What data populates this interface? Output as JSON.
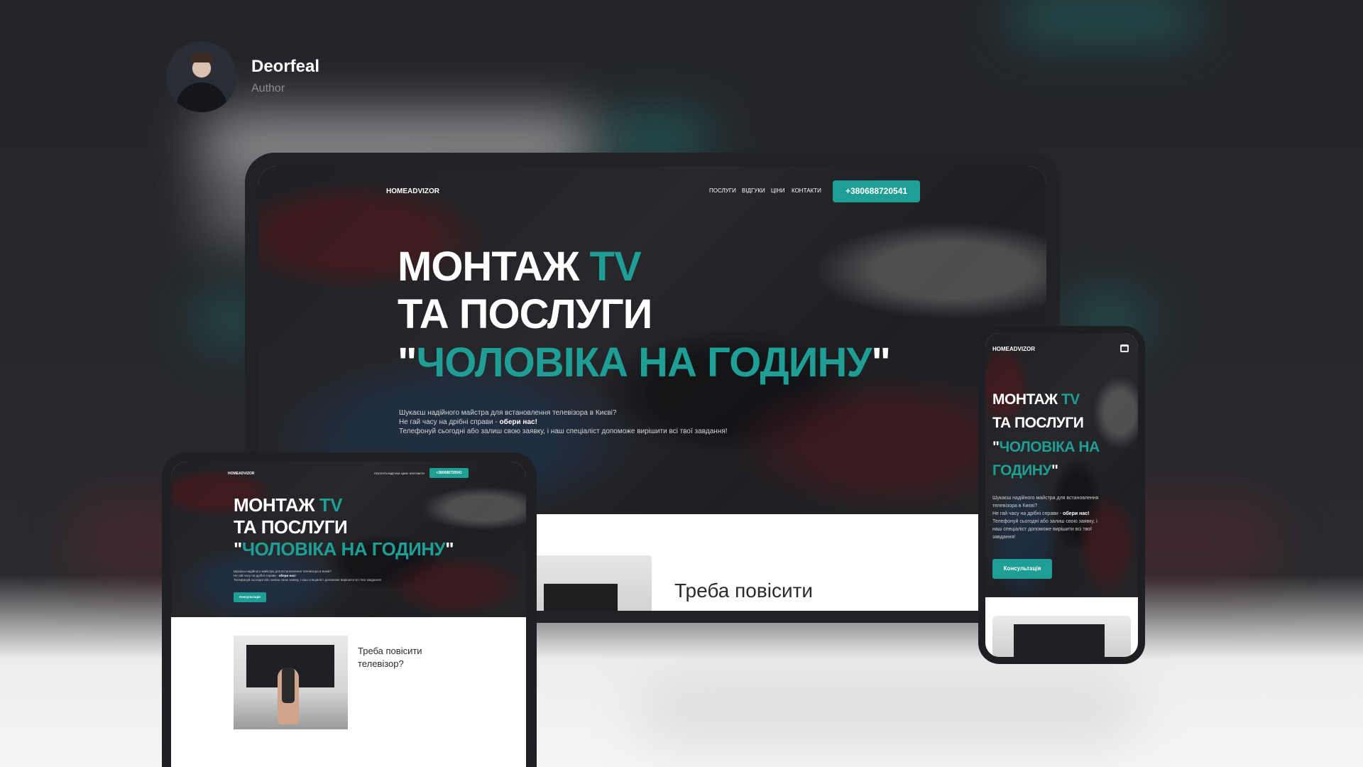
{
  "author": {
    "name": "Deorfeal",
    "role": "Author"
  },
  "colors": {
    "accent": "#1f9e95",
    "dark": "#202225"
  },
  "site": {
    "brand": "HOMEADVIZOR",
    "nav": [
      "ПОСЛУГИ",
      "ВІДГУКИ",
      "ЦІНИ",
      "КОНТАКТИ"
    ],
    "phone": "+380688720541",
    "hero": {
      "line1_a": "МОНТАЖ ",
      "line1_b": "TV",
      "line2": "ТА ПОСЛУГИ",
      "line3_q1": "\"",
      "line3_accent": "ЧОЛОВІКА НА ГОДИНУ",
      "line3_q2": "\"",
      "phone_line3_accent": "ЧОЛОВІКА НА",
      "phone_line4_accent": "ГОДИНУ",
      "p1": "Шукаєш надійного майстра для встановлення телевізора в Києві?",
      "p2_a": "Не гай часу на дрібні справи - ",
      "p2_b": "обери нас!",
      "p3": "Телефонуй сьогодні або залиш свою заявку, і наш спеціаліст допоможе вирішити всі твої завдання!",
      "phone_p1": "Шукаєш надійного майстра для встановлення",
      "phone_p2": "телевізора в Києві?",
      "phone_p3_a": "Не гай часу на дрібні справи - ",
      "phone_p3_b": "обери нас!",
      "phone_p4": "Телефонуй сьогодні або залиш свою заявку, і",
      "phone_p5": "наш спеціаліст допоможе вирішити всі твої",
      "phone_p6": "завдання!",
      "cta": "Консультація"
    },
    "card": {
      "title_laptop": "Треба повісити",
      "title_line1": "Треба повісити",
      "title_line2": "телевізор?"
    }
  }
}
